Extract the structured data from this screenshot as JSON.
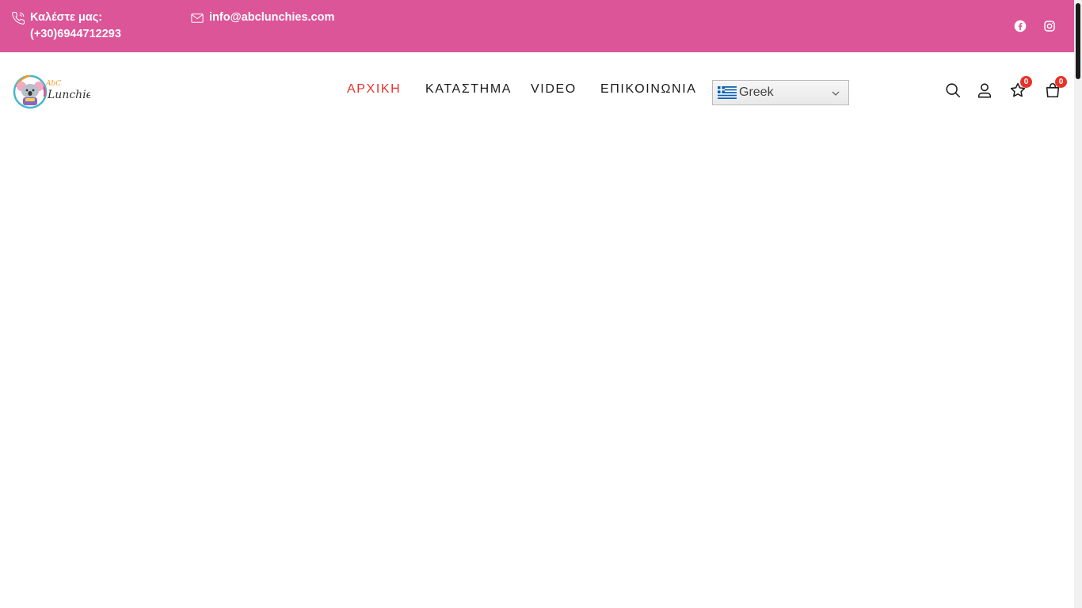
{
  "topbar": {
    "background": "#dc5598",
    "phone": {
      "label": "Καλέστε μας:",
      "number": "(+30)6944712293",
      "icon": "phone-icon"
    },
    "email": {
      "address": "info@abclunchies.com",
      "icon": "envelope-icon"
    },
    "social": [
      "facebook-icon",
      "instagram-icon"
    ]
  },
  "header": {
    "logo": {
      "top_text": "AbC",
      "main_text": "Lunchies"
    },
    "nav": [
      {
        "label": "ΑΡΧΙΚΗ",
        "active": true
      },
      {
        "label": "ΚΑΤΑΣΤΗΜΑ",
        "active": false
      },
      {
        "label": "VIDEO",
        "active": false
      },
      {
        "label": "ΕΠΙΚΟΙΝΩΝΙΑ",
        "active": false
      }
    ],
    "language": {
      "selected": "Greek",
      "icon": "greece-flag-icon"
    },
    "icons": {
      "search": "search-icon",
      "account": "user-icon",
      "wishlist": {
        "icon": "star-icon",
        "count": "0"
      },
      "cart": {
        "icon": "shopping-bag-icon",
        "count": "0"
      }
    }
  },
  "colors": {
    "accent": "#e6332a",
    "brand_pink": "#dc5598",
    "nav_text": "#1b1b1b"
  }
}
